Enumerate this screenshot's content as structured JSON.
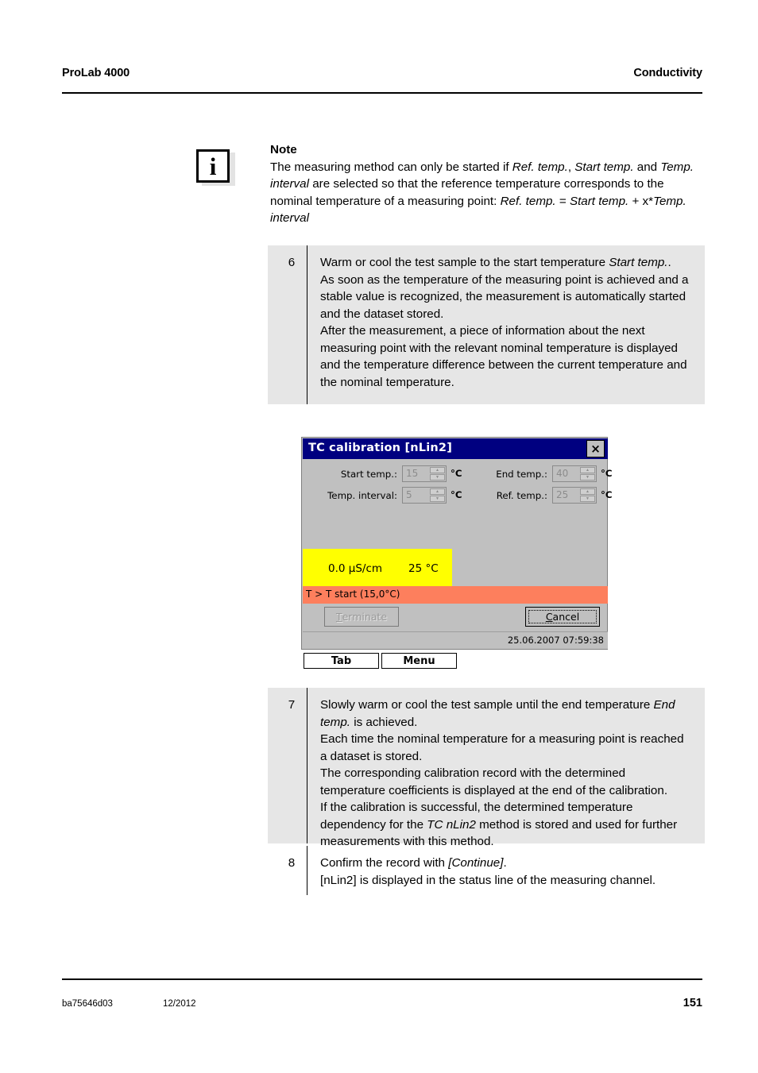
{
  "header": {
    "product": "ProLab 4000",
    "section": "Conductivity"
  },
  "note": {
    "icon": "info-icon",
    "icon_glyph": "i",
    "title": "Note",
    "line1_a": "The measuring method can only be started if ",
    "line1_i1": "Ref. temp.",
    "line1_b": ", ",
    "line1_i2": "Start temp.",
    "line2_a": " and ",
    "line2_i1": "Temp. interval",
    "line2_b": " are selected so that the reference temperature corresponds to the nominal temperature of a measuring point: ",
    "line2_i2": "Ref. temp.",
    "line3_a": " = ",
    "line3_i1": "Start temp.",
    "line3_b": " + x*",
    "line3_i2": "Temp. interval"
  },
  "steps": {
    "step6": {
      "number": "6",
      "p1_a": "Warm or cool the test sample to the start temperature ",
      "p1_i": "Start temp.",
      "p1_b": ".",
      "p2": "As soon as the temperature of the measuring point is achieved and a stable value is recognized, the measurement is automatically started and the dataset stored.",
      "p3": "After the measurement, a piece of information about the next measuring point with the relevant nominal temperature is displayed and the temperature difference between the current temperature and the nominal temperature."
    },
    "step7": {
      "number": "7",
      "p1_a": "Slowly warm or cool the test sample until the end temperature ",
      "p1_i": "End temp.",
      "p1_b": " is achieved.",
      "p2": "Each time the nominal temperature for a measuring point is reached a dataset is stored.",
      "p3": "The corresponding calibration record with the determined temperature coefficients is displayed at the end of the calibration.",
      "p4_a": "If the calibration is successful, the determined temperature dependency for the ",
      "p4_i": "TC nLin2",
      "p4_b": " method is stored and used for further measurements with this method."
    },
    "step8": {
      "number": "8",
      "p1_a": "Confirm the record with ",
      "p1_i": "[Continue]",
      "p1_b": ".",
      "p2": "[nLin2] is displayed in the status line of the measuring channel."
    }
  },
  "device": {
    "title": "TC calibration [nLin2]",
    "close_glyph": "×",
    "fields": [
      {
        "label": "Start temp.:",
        "value": "15",
        "unit": "°C"
      },
      {
        "label": "End temp.:",
        "value": "40",
        "unit": "°C"
      },
      {
        "label": "Temp. interval:",
        "value": "5",
        "unit": "°C"
      },
      {
        "label": "Ref. temp.:",
        "value": "25",
        "unit": "°C"
      }
    ],
    "spinner_up_glyph": "▲",
    "spinner_down_glyph": "▼",
    "reading": {
      "value": "0.0 µS/cm",
      "temperature": "25 °C"
    },
    "status": "T > T start (15,0°C)",
    "buttons": {
      "terminate_mnemonic": "T",
      "terminate_rest": "erminate",
      "cancel_mnemonic": "C",
      "cancel_rest": "ancel"
    },
    "timestamp": "25.06.2007 07:59:38",
    "softkeys": {
      "tab": "Tab",
      "menu": "Menu"
    },
    "colors": {
      "titlebar": "#000080",
      "dialog_bg": "#c0c0c0",
      "reading_bg": "#ffff00",
      "status_bg": "#fd7f5d"
    }
  },
  "footer": {
    "doc_id": "ba75646d03",
    "date": "12/2012",
    "page": "151"
  }
}
